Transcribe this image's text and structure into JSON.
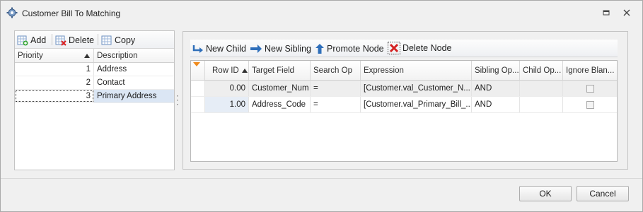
{
  "window": {
    "title": "Customer Bill To Matching",
    "icon": "settings-gear-icon",
    "controls": [
      "restore-icon",
      "close-icon"
    ]
  },
  "left_toolbar": {
    "add_label": "Add",
    "delete_label": "Delete",
    "copy_label": "Copy"
  },
  "left_grid": {
    "columns": [
      "Priority",
      "Description"
    ],
    "sort_column": "Priority",
    "rows": [
      {
        "priority": "1",
        "description": "Address"
      },
      {
        "priority": "2",
        "description": "Contact"
      },
      {
        "priority": "3",
        "description": "Primary Address"
      }
    ],
    "selected_row": 3
  },
  "right_toolbar": {
    "new_child_label": "New Child",
    "new_sibling_label": "New Sibling",
    "promote_node_label": "Promote Node",
    "delete_node_label": "Delete Node"
  },
  "right_grid": {
    "columns": [
      "Row ID",
      "Target Field",
      "Search Op",
      "Expression",
      "Sibling Op...",
      "Child Op...",
      "Ignore Blan..."
    ],
    "sort_column": "Row ID",
    "rows": [
      {
        "row_id": "0.00",
        "target_field": "Customer_Num",
        "search_op": "=",
        "expression": "[Customer.val_Customer_N...",
        "sibling_op": "AND",
        "child_op": "",
        "ignore_blank": false
      },
      {
        "row_id": "1.00",
        "target_field": "Address_Code",
        "search_op": "=",
        "expression": "[Customer.val_Primary_Bill_...",
        "sibling_op": "AND",
        "child_op": "",
        "ignore_blank": false
      }
    ]
  },
  "buttons": {
    "ok_label": "OK",
    "cancel_label": "Cancel"
  },
  "colors": {
    "selected_row": "#dbe6f4",
    "row_highlight": "#eeeeee",
    "window_bg": "#f0f0f0"
  }
}
